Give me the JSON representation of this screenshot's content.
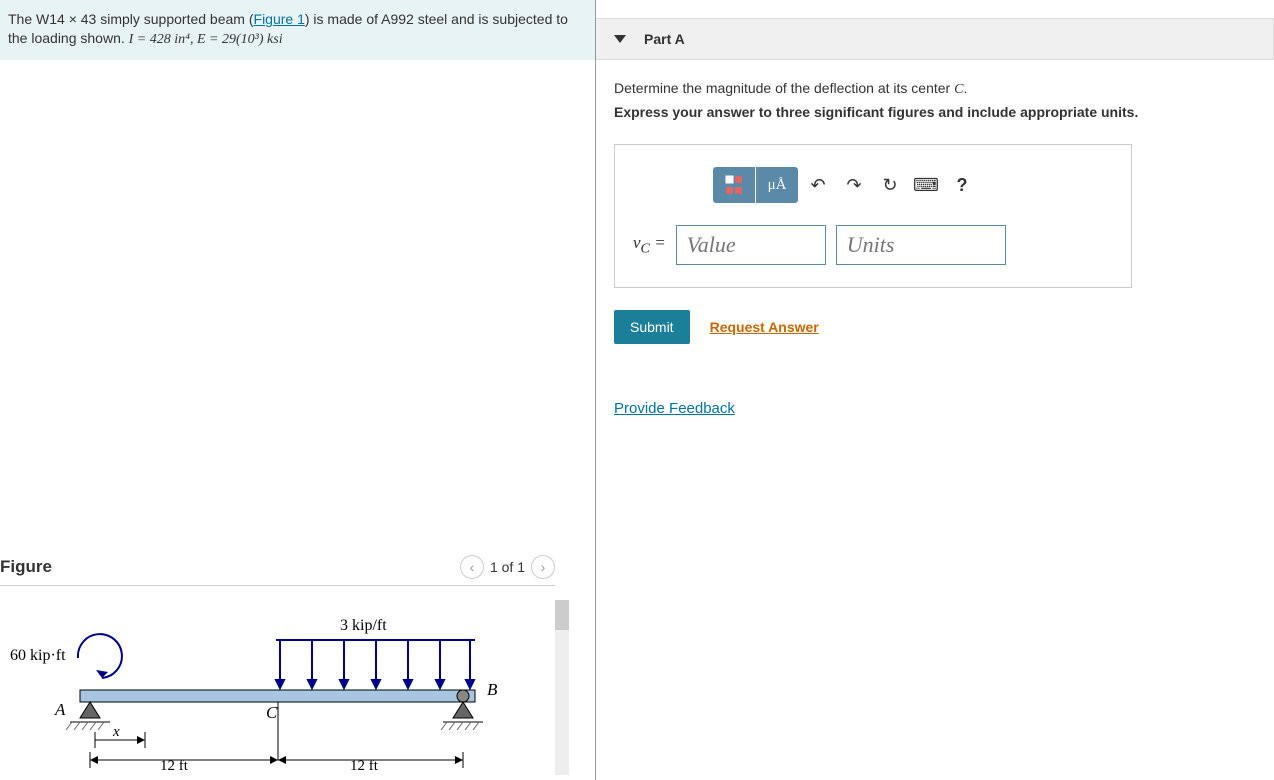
{
  "problem": {
    "text_a": "The W14 × 43 simply supported beam (",
    "fig_link": "Figure 1",
    "text_b": ") is made of A992 steel and is subjected to the loading shown. ",
    "eq": "I = 428 in⁴,  E = 29(10³) ksi"
  },
  "figure": {
    "title": "Figure",
    "pager": "1 of 1"
  },
  "diagram": {
    "moment": "60 kip·ft",
    "load": "3 kip/ft",
    "A": "A",
    "B": "B",
    "C": "C",
    "x": "x",
    "span1": "12 ft",
    "span2": "12 ft"
  },
  "part": {
    "title": "Part A"
  },
  "question": {
    "text": "Determine the magnitude of the deflection at its center ",
    "var": "C",
    "end": "."
  },
  "instruction": "Express your answer to three significant figures and include appropriate units.",
  "toolbar": {
    "template": "▭",
    "units": "μÅ",
    "undo": "↶",
    "redo": "↷",
    "reset": "↻",
    "keyboard": "⌨",
    "help": "?"
  },
  "input": {
    "label": "v",
    "sub": "C",
    "eq": " = ",
    "value_ph": "Value",
    "units_ph": "Units"
  },
  "actions": {
    "submit": "Submit",
    "request": "Request Answer"
  },
  "feedback": "Provide Feedback"
}
